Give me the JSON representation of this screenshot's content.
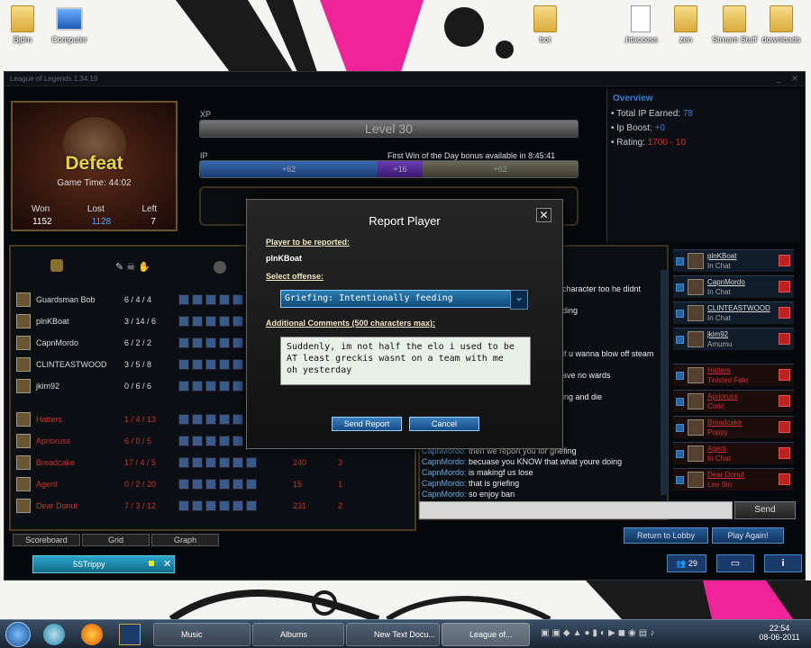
{
  "desktop": {
    "icons_left": [
      {
        "label": "Bjdm"
      },
      {
        "label": "Computer"
      }
    ],
    "icons_right": [
      {
        "label": "bot"
      },
      {
        "label": ".htaccess"
      },
      {
        "label": "zen"
      },
      {
        "label": "Stream Stuff"
      },
      {
        "label": "downloads"
      }
    ]
  },
  "window": {
    "title": "League of Legends 1.34.19"
  },
  "game": {
    "result": "Defeat",
    "game_time": "Game Time: 44:02",
    "stats": {
      "won_label": "Won",
      "lost_label": "Lost",
      "left_label": "Left",
      "won": "1152",
      "lost": "1128",
      "left": "7"
    },
    "xp_label": "XP",
    "level_text": "Level 30",
    "ip_label": "IP",
    "ip_bonus_text": "First Win of the Day bonus available in 8:45:41",
    "ip_values": [
      "+62",
      "+16",
      "+62"
    ],
    "ip_segments": [
      0.47,
      0.12,
      0.41
    ]
  },
  "overview": {
    "title": "Overview",
    "total_ip": "Total IP Earned:",
    "total_ip_value": "78",
    "ip_boost": "Ip Boost:",
    "ip_boost_value": "+0",
    "rating": "Rating:",
    "rating_value": "1700 - 10"
  },
  "team_blue": [
    {
      "name": "Guardsman Bob",
      "kda": "6 / 4 / 4"
    },
    {
      "name": "plnKBoat",
      "kda": "3 / 14 / 6"
    },
    {
      "name": "CapnMordo",
      "kda": "6 / 2 / 2"
    },
    {
      "name": "CLINTEASTWOOD",
      "kda": "3 / 5 / 8"
    },
    {
      "name": "jkim92",
      "kda": "0 / 6 / 6"
    }
  ],
  "team_red": [
    {
      "name": "Hatters",
      "kda": "1 / 4 / 13",
      "cs": "",
      "g": ""
    },
    {
      "name": "Aprioruss",
      "kda": "6 / 0 / 5",
      "cs": "",
      "g": ""
    },
    {
      "name": "Breadcake",
      "kda": "17 / 4 / 5",
      "cs": "240",
      "g": "3"
    },
    {
      "name": "Agent",
      "kda": "0 / 2 / 20",
      "cs": "15",
      "g": "1"
    },
    {
      "name": "Dear Donut",
      "kda": "7 / 3 / 12",
      "cs": "231",
      "g": "2"
    }
  ],
  "tabs": {
    "scoreboard": "Scoreboard",
    "grid": "Grid",
    "graph": "Graph"
  },
  "chat": {
    "fragments": [
      "character too he didnt",
      "ding",
      "if u wanna blow off steam",
      "ave no wards",
      "ing and die"
    ],
    "lines": [
      {
        "name": "CapnMordo:",
        "text": "then we report you for griefing"
      },
      {
        "name": "CapnMordo:",
        "text": "becuase you KNOW that what youre doing"
      },
      {
        "name": "CapnMordo:",
        "text": "is makingf us lose"
      },
      {
        "name": "CapnMordo:",
        "text": "that is griefing"
      },
      {
        "name": "CapnMordo:",
        "text": "so enjoy ban"
      }
    ],
    "send": "Send"
  },
  "players_list": [
    {
      "name": "plnKBoat",
      "status": "In Chat",
      "team": "blue"
    },
    {
      "name": "CapnMordo",
      "status": "In Chat",
      "team": "blue"
    },
    {
      "name": "CLINTEASTWOOD",
      "status": "In Chat",
      "team": "blue"
    },
    {
      "name": "jkim92",
      "status": "Amumu",
      "team": "blue"
    },
    {
      "name": "Hatters",
      "status": "Twisted Fate",
      "team": "red"
    },
    {
      "name": "Aprioruss",
      "status": "Corki",
      "team": "red"
    },
    {
      "name": "Breadcake",
      "status": "Poppy",
      "team": "red"
    },
    {
      "name": "Agent",
      "status": "In Chat",
      "team": "red"
    },
    {
      "name": "Dear Donut",
      "status": "Lee Sin",
      "team": "red"
    }
  ],
  "buttons": {
    "return_lobby": "Return to Lobby",
    "play_again": "Play Again!"
  },
  "bottom_chat": {
    "tab": "5STrippy",
    "count": "29"
  },
  "report": {
    "title": "Report Player",
    "player_label": "Player to be reported:",
    "player_name": "plnKBoat",
    "offense_label": "Select offense:",
    "offense_value": "Griefing: Intentionally feeding",
    "comments_label": "Additional Comments (500 characters max):",
    "comments_text": "Suddenly, im not half the elo i used to be\nAT least greckis wasnt on a team with me\noh yesterday",
    "send": "Send Report",
    "cancel": "Cancel"
  },
  "taskbar": {
    "items": [
      "Music",
      "Albums",
      "New Text Docu...",
      "League of..."
    ],
    "time": "22:54",
    "date": "08-06-2011"
  },
  "colors": {
    "accent_gold": "#e8d24a",
    "link_blue": "#6ad",
    "enemy_red": "#c33"
  }
}
